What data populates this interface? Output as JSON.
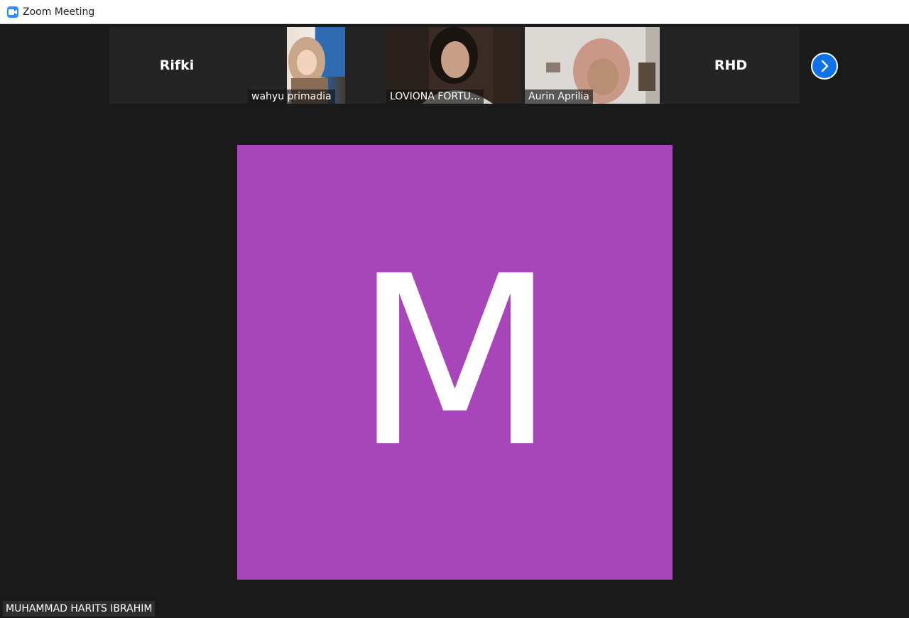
{
  "window": {
    "title": "Zoom Meeting",
    "icon": "zoom-camera-icon"
  },
  "gallery_strip": {
    "participants": [
      {
        "name": "Rifki",
        "video": false
      },
      {
        "name": "wahyu primadia",
        "video": true
      },
      {
        "name": "LOVIONA FORTU...",
        "video": true
      },
      {
        "name": "Aurin Aprilia",
        "video": true
      },
      {
        "name": "RHD",
        "video": false
      }
    ],
    "next_icon": "chevron-right-icon"
  },
  "active_speaker": {
    "initial": "M",
    "name": "MUHAMMAD HARITS IBRAHIM",
    "avatar_color": "#a945bb"
  },
  "colors": {
    "background": "#1a1a1a",
    "accent": "#0e72ed"
  }
}
